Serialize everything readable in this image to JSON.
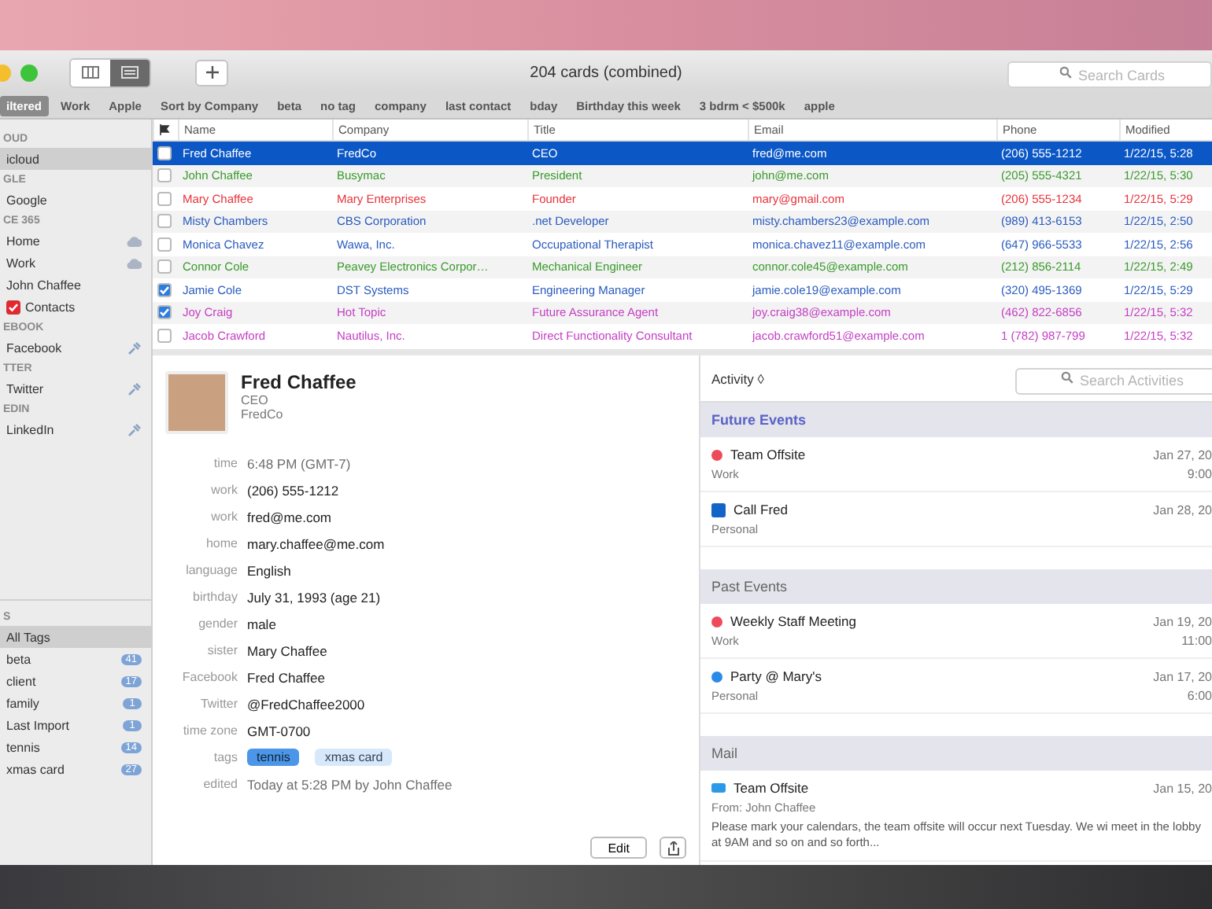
{
  "window": {
    "title": "204 cards (combined)",
    "search": {
      "placeholder": "Search Cards"
    },
    "view_modes": [
      {
        "selected": false
      },
      {
        "selected": true
      }
    ]
  },
  "filters": [
    {
      "label": "iltered",
      "selected": true
    },
    {
      "label": "Work",
      "selected": false
    },
    {
      "label": "Apple",
      "selected": false
    },
    {
      "label": "Sort by Company",
      "selected": false
    },
    {
      "label": "beta",
      "selected": false
    },
    {
      "label": "no tag",
      "selected": false
    },
    {
      "label": "company",
      "selected": false
    },
    {
      "label": "last contact",
      "selected": false
    },
    {
      "label": "bday",
      "selected": false
    },
    {
      "label": "Birthday this week",
      "selected": false
    },
    {
      "label": "3 bdrm < $500k",
      "selected": false
    },
    {
      "label": "apple",
      "selected": false
    }
  ],
  "sidebar": {
    "sections": [
      {
        "heading": "OUD",
        "items": [
          {
            "label": "icloud",
            "kind": "plain",
            "selected": true
          }
        ]
      },
      {
        "heading": "GLE",
        "items": [
          {
            "label": "Google",
            "kind": "plain",
            "selected": false
          }
        ]
      },
      {
        "heading": "CE 365",
        "items": [
          {
            "label": "Home",
            "kind": "shared",
            "selected": false
          },
          {
            "label": "Work",
            "kind": "shared",
            "selected": false
          },
          {
            "label": "John Chaffee",
            "kind": "plain",
            "selected": false
          },
          {
            "label": "Contacts",
            "kind": "checkbox",
            "checked": true,
            "selected": false
          }
        ]
      },
      {
        "heading": "EBOOK",
        "items": [
          {
            "label": "Facebook",
            "kind": "linked",
            "selected": false
          }
        ]
      },
      {
        "heading": "TTER",
        "items": [
          {
            "label": "Twitter",
            "kind": "linked",
            "selected": false
          }
        ]
      },
      {
        "heading": "EDIN",
        "items": [
          {
            "label": "LinkedIn",
            "kind": "linked",
            "selected": false
          }
        ]
      }
    ],
    "tags_heading": "S",
    "tags": [
      {
        "label": "All Tags",
        "selected": true
      },
      {
        "label": "beta",
        "count": "41",
        "selected": false
      },
      {
        "label": "client",
        "count": "17",
        "selected": false
      },
      {
        "label": "family",
        "count": "1",
        "selected": false
      },
      {
        "label": "Last Import",
        "count": "1",
        "selected": false
      },
      {
        "label": "tennis",
        "count": "14",
        "selected": false
      },
      {
        "label": "xmas card",
        "count": "27",
        "selected": false
      }
    ]
  },
  "table": {
    "columns": [
      "Name",
      "Company",
      "Title",
      "Email",
      "Phone",
      "Modified"
    ],
    "rows": [
      {
        "selected": true,
        "checked": false,
        "cells": [
          "Fred Chaffee",
          "FredCo",
          "CEO",
          "fred@me.com",
          "(206) 555-1212",
          "1/22/15, 5:28"
        ]
      },
      {
        "selected": false,
        "checked": false,
        "color": "#3a9a2c",
        "cells": [
          "John Chaffee",
          "Busymac",
          "President",
          "john@me.com",
          "(205) 555-4321",
          "1/22/15, 5:30"
        ]
      },
      {
        "selected": false,
        "checked": false,
        "color": "#e8323a",
        "cells": [
          "Mary Chaffee",
          "Mary Enterprises",
          "Founder",
          "mary@gmail.com",
          "(206) 555-1234",
          "1/22/15, 5:29"
        ]
      },
      {
        "selected": false,
        "checked": false,
        "color": "#2a5bbf",
        "cells": [
          "Misty Chambers",
          "CBS Corporation",
          ".net Developer",
          "misty.chambers23@example.com",
          "(989) 413-6153",
          "1/22/15, 2:50"
        ]
      },
      {
        "selected": false,
        "checked": false,
        "color": "#2a5bbf",
        "cells": [
          "Monica Chavez",
          "Wawa, Inc.",
          "Occupational Therapist",
          "monica.chavez11@example.com",
          "(647) 966-5533",
          "1/22/15, 2:56"
        ]
      },
      {
        "selected": false,
        "checked": false,
        "color": "#3a9a2c",
        "cells": [
          "Connor Cole",
          "Peavey Electronics Corpor…",
          "Mechanical Engineer",
          "connor.cole45@example.com",
          "(212) 856-2114",
          "1/22/15, 2:49"
        ]
      },
      {
        "selected": false,
        "checked": true,
        "color": "#2a5bbf",
        "cells": [
          "Jamie Cole",
          "DST Systems",
          "Engineering Manager",
          "jamie.cole19@example.com",
          "(320) 495-1369",
          "1/22/15, 5:29"
        ]
      },
      {
        "selected": false,
        "checked": true,
        "color": "#c43ec4",
        "cells": [
          "Joy Craig",
          "Hot Topic",
          "Future Assurance Agent",
          "joy.craig38@example.com",
          "(462) 822-6856",
          "1/22/15, 5:32"
        ]
      },
      {
        "selected": false,
        "checked": false,
        "color": "#c43ec4",
        "cells": [
          "Jacob Crawford",
          "Nautilus, Inc.",
          "Direct Functionality Consultant",
          "jacob.crawford51@example.com",
          "1 (782) 987-799",
          "1/22/15, 5:32"
        ]
      }
    ]
  },
  "contact": {
    "name": "Fred Chaffee",
    "title": "CEO",
    "company": "FredCo",
    "fields": [
      {
        "label": "time",
        "value": "6:48 PM (GMT-7)",
        "muted": true,
        "kind": "text"
      },
      {
        "label": "work",
        "value": "(206) 555-1212",
        "muted": false,
        "kind": "text"
      },
      {
        "label": "work",
        "value": "fred@me.com",
        "muted": false,
        "kind": "text"
      },
      {
        "label": "home",
        "value": "mary.chaffee@me.com",
        "muted": false,
        "kind": "text"
      },
      {
        "label": "language",
        "value": "English",
        "muted": false,
        "kind": "text"
      },
      {
        "label": "birthday",
        "value": "July 31, 1993 (age 21)",
        "muted": false,
        "kind": "text"
      },
      {
        "label": "gender",
        "value": "male",
        "muted": false,
        "kind": "text"
      },
      {
        "label": "sister",
        "value": "Mary Chaffee",
        "muted": false,
        "kind": "text"
      },
      {
        "label": "Facebook",
        "value": "Fred Chaffee",
        "muted": false,
        "kind": "text"
      },
      {
        "label": "Twitter",
        "value": "@FredChaffee2000",
        "muted": false,
        "kind": "text"
      },
      {
        "label": "time zone",
        "value": "GMT-0700",
        "muted": false,
        "kind": "text"
      },
      {
        "label": "tags",
        "kind": "tags",
        "tags": [
          {
            "label": "tennis",
            "selected": true
          },
          {
            "label": "xmas card",
            "selected": false
          }
        ]
      },
      {
        "label": "edited",
        "value": "Today at 5:28 PM by John Chaffee",
        "muted": true,
        "kind": "text"
      }
    ],
    "edit_button": "Edit"
  },
  "activity": {
    "menu": "Activity ◊",
    "search": {
      "placeholder": "Search Activities"
    },
    "sections": [
      {
        "title": "Future Events",
        "selected": true,
        "items": [
          {
            "kind": "event",
            "color": "#ee4b5a",
            "title": "Team Offsite",
            "subtitle": "Work",
            "date": "Jan 27, 20",
            "time": "9:00"
          },
          {
            "kind": "task",
            "color": "#1463c8",
            "title": "Call Fred",
            "subtitle": "Personal",
            "date": "Jan 28, 20"
          }
        ]
      },
      {
        "title": "Past Events",
        "selected": false,
        "items": [
          {
            "kind": "event",
            "color": "#ee4b5a",
            "title": "Weekly Staff Meeting",
            "subtitle": "Work",
            "date": "Jan 19, 20",
            "time": "11:00"
          },
          {
            "kind": "event",
            "color": "#2a8ae8",
            "title": "Party @ Mary's",
            "subtitle": "Personal",
            "date": "Jan 17, 20",
            "time": "6:00"
          }
        ]
      },
      {
        "title": "Mail",
        "selected": false,
        "items": [
          {
            "kind": "mail",
            "color": "#2a9ae8",
            "title": "Team Offsite",
            "subtitle": "From: John Chaffee",
            "body": "Please mark your calendars, the team offsite will occur next Tuesday. We wi meet in the lobby at 9AM and so on and so forth...",
            "date": "Jan 15, 20"
          }
        ]
      }
    ]
  }
}
